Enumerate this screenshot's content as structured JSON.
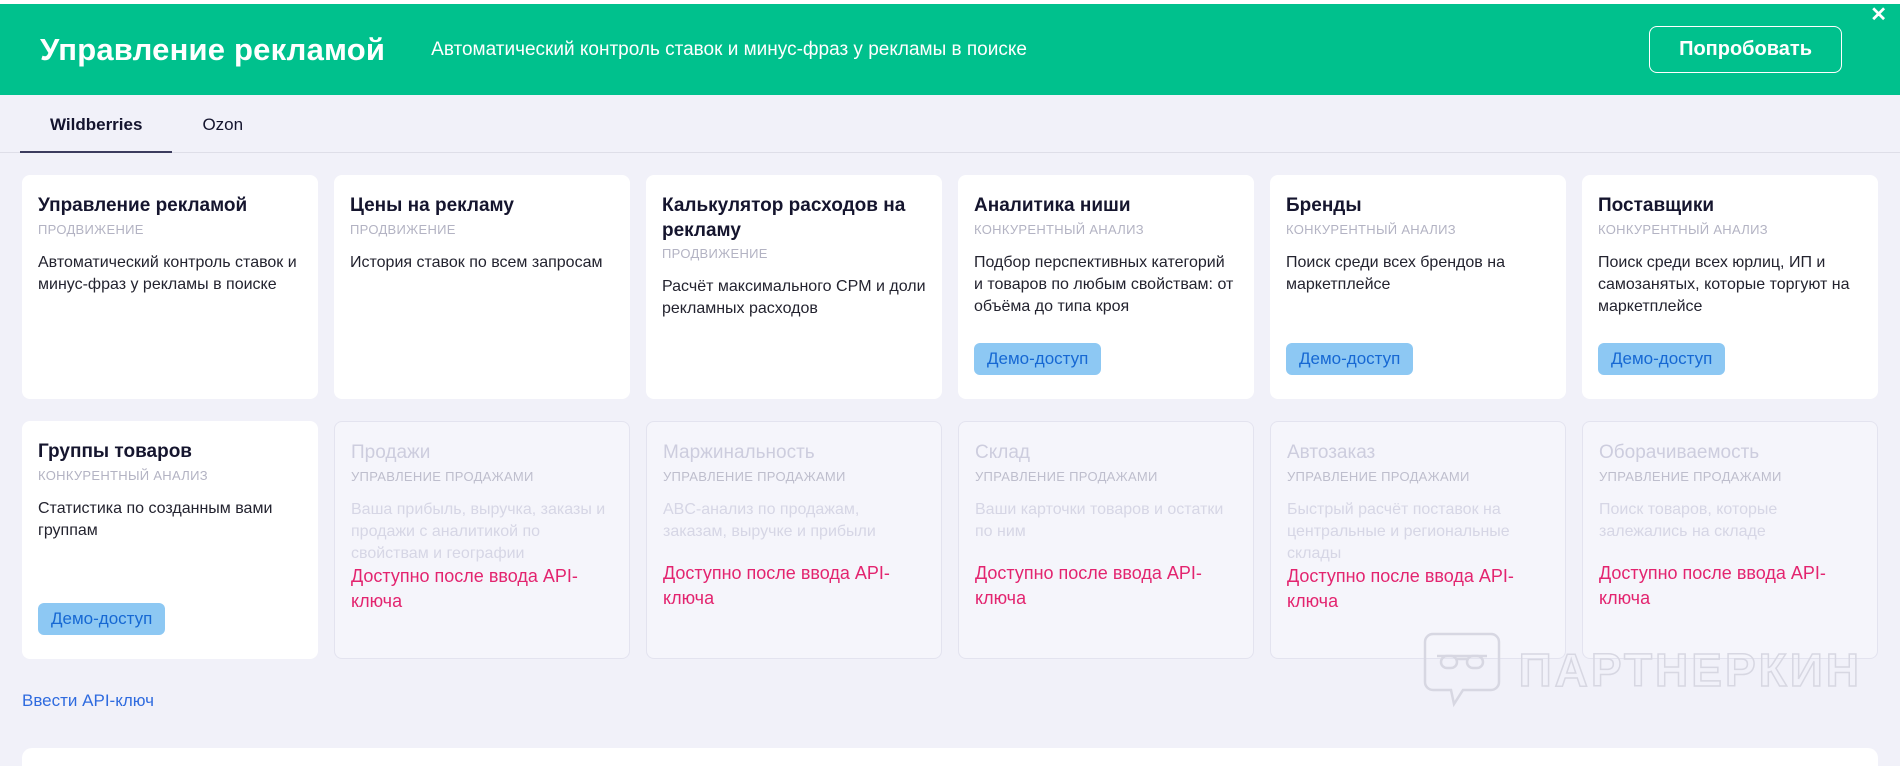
{
  "banner": {
    "title": "Управление рекламой",
    "subtitle": "Автоматический контроль ставок и минус-фраз у рекламы в поиске",
    "cta_label": "Попробовать",
    "close_icon": "✕",
    "background_color": "#00c18d"
  },
  "tabs": [
    {
      "label": "Wildberries",
      "active": true
    },
    {
      "label": "Ozon",
      "active": false
    }
  ],
  "cards": [
    {
      "title": "Управление рекламой",
      "category": "ПРОДВИЖЕНИЕ",
      "description": "Автоматический контроль ставок и минус-фраз у рекламы в поиске",
      "badge": null,
      "locked_note": null,
      "state": "active"
    },
    {
      "title": "Цены на рекламу",
      "category": "ПРОДВИЖЕНИЕ",
      "description": "История ставок по всем запросам",
      "badge": null,
      "locked_note": null,
      "state": "active"
    },
    {
      "title": "Калькулятор расходов на рекламу",
      "category": "ПРОДВИЖЕНИЕ",
      "description": "Расчёт максимального CPM и доли рекламных расходов",
      "badge": null,
      "locked_note": null,
      "state": "active"
    },
    {
      "title": "Аналитика ниши",
      "category": "КОНКУРЕНТНЫЙ АНАЛИЗ",
      "description": "Подбор перспективных категорий и товаров по любым свойствам: от объёма до типа кроя",
      "badge": "Демо-доступ",
      "locked_note": null,
      "state": "demo"
    },
    {
      "title": "Бренды",
      "category": "КОНКУРЕНТНЫЙ АНАЛИЗ",
      "description": "Поиск среди всех брендов на маркетплейсе",
      "badge": "Демо-доступ",
      "locked_note": null,
      "state": "demo"
    },
    {
      "title": "Поставщики",
      "category": "КОНКУРЕНТНЫЙ АНАЛИЗ",
      "description": "Поиск среди всех юрлиц, ИП и самозанятых, которые торгуют на маркетплейсе",
      "badge": "Демо-доступ",
      "locked_note": null,
      "state": "demo"
    },
    {
      "title": "Группы товаров",
      "category": "КОНКУРЕНТНЫЙ АНАЛИЗ",
      "description": "Статистика по созданным вами группам",
      "badge": "Демо-доступ",
      "locked_note": null,
      "state": "demo"
    },
    {
      "title": "Продажи",
      "category": "УПРАВЛЕНИЕ ПРОДАЖАМИ",
      "description": "Ваша прибыль, выручка, заказы и продажи с аналитикой по свойствам и географии",
      "badge": null,
      "locked_note": "Доступно после ввода API-ключа",
      "state": "locked"
    },
    {
      "title": "Маржинальность",
      "category": "УПРАВЛЕНИЕ ПРОДАЖАМИ",
      "description": "ABC-анализ по продажам, заказам, выручке и прибыли",
      "badge": null,
      "locked_note": "Доступно после ввода API-ключа",
      "state": "locked"
    },
    {
      "title": "Склад",
      "category": "УПРАВЛЕНИЕ ПРОДАЖАМИ",
      "description": "Ваши карточки товаров и остатки по ним",
      "badge": null,
      "locked_note": "Доступно после ввода API-ключа",
      "state": "locked"
    },
    {
      "title": "Автозаказ",
      "category": "УПРАВЛЕНИЕ ПРОДАЖАМИ",
      "description": "Быстрый расчёт поставок на центральные и региональные склады",
      "badge": null,
      "locked_note": "Доступно после ввода API-ключа",
      "state": "locked"
    },
    {
      "title": "Оборачиваемость",
      "category": "УПРАВЛЕНИЕ ПРОДАЖАМИ",
      "description": "Поиск товаров, которые залежались на складе",
      "badge": null,
      "locked_note": "Доступно после ввода API-ключа",
      "state": "locked"
    }
  ],
  "api_key_link_label": "Ввести API-ключ",
  "watermark_text": "ПАРТНЕРКИН",
  "colors": {
    "banner_green": "#00c18d",
    "page_background": "#f1f1f9",
    "badge_background": "#8dc8f3",
    "badge_text": "#1668d3",
    "locked_note_pink": "#e3246f",
    "link_blue": "#2f6bdf",
    "tab_underline": "#3c3c5e",
    "watermark_gray": "#d7d7e2"
  }
}
